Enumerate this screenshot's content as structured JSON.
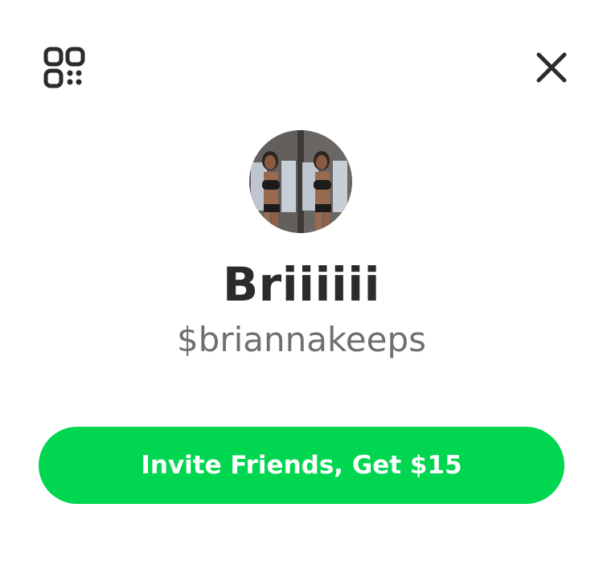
{
  "header": {
    "scan_icon": "qr-code-icon",
    "close_icon": "close-icon"
  },
  "profile": {
    "display_name": "Briiiiii",
    "cashtag": "$briannakeeps",
    "avatar": "profile-photo"
  },
  "actions": {
    "invite_label": "Invite Friends, Get $15"
  },
  "colors": {
    "accent": "#00d64f",
    "name_text": "#2b2b2b",
    "cashtag_text": "#6f6f6f",
    "icon": "#2b2b2b",
    "background": "#ffffff"
  }
}
